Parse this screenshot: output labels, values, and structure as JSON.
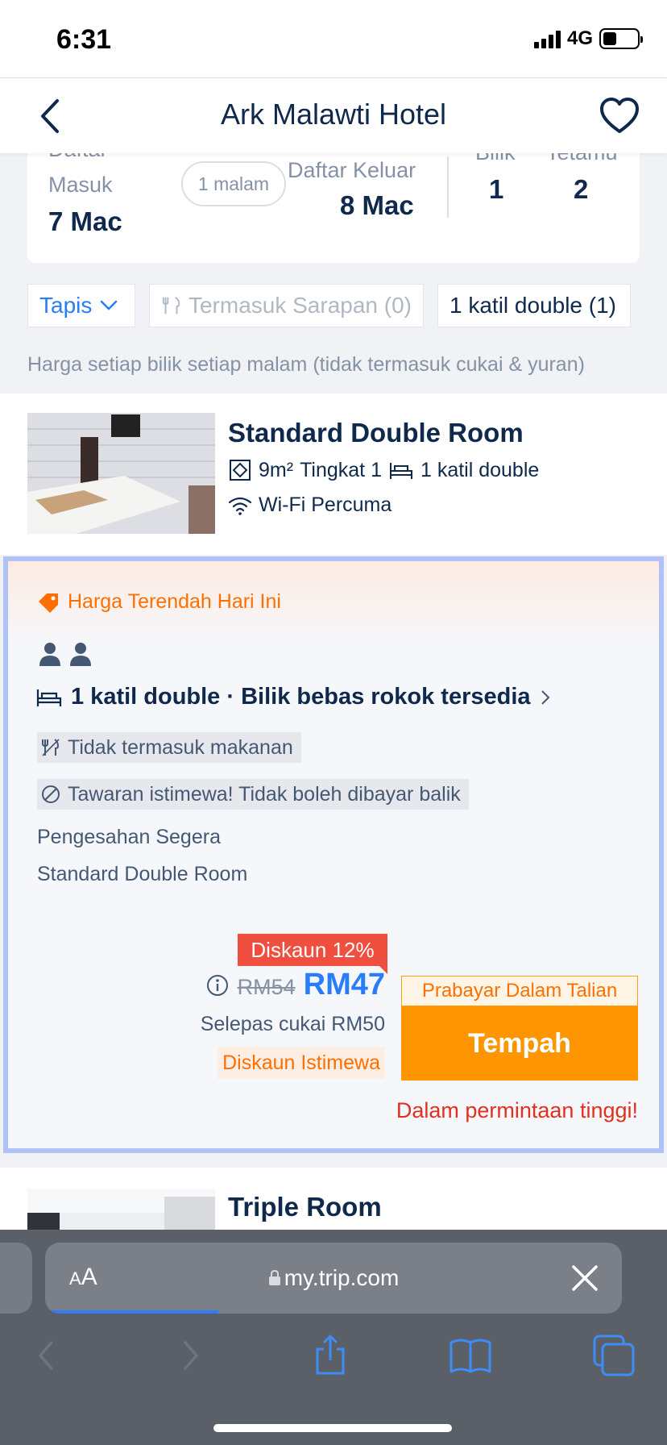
{
  "status_bar": {
    "time": "6:31",
    "network": "4G"
  },
  "header": {
    "title": "Ark Malawti Hotel"
  },
  "search_summary": {
    "checkin_label_line1": "Daftar",
    "checkin_label_line2": "Masuk",
    "checkin_date": "7 Mac",
    "nights": "1 malam",
    "checkout_label": "Daftar Keluar",
    "checkout_date": "8 Mac",
    "rooms_label": "Bilik",
    "rooms": "1",
    "guests_label": "Tetamu",
    "guests": "2"
  },
  "filters": {
    "filter_label": "Tapis",
    "breakfast_chip": "Termasuk Sarapan (0)",
    "bed_chip": "1 katil double (1)"
  },
  "price_note": "Harga setiap bilik setiap malam (tidak termasuk cukai & yuran)",
  "rooms": [
    {
      "name": "Standard Double Room",
      "size": "9m²",
      "floor": "Tingkat 1",
      "bed": "1 katil double",
      "wifi": "Wi-Fi Percuma"
    },
    {
      "name": "Triple Room"
    }
  ],
  "offer": {
    "banner": "Harga Terendah Hari Ini",
    "bed_policy": "1 katil double · Bilik bebas rokok tersedia",
    "meal": "Tidak termasuk makanan",
    "refund": "Tawaran istimewa! Tidak boleh dibayar balik",
    "confirmation": "Pengesahan Segera",
    "room_name": "Standard Double Room",
    "discount_badge": "Diskaun 12%",
    "old_price": "RM54",
    "new_price": "RM47",
    "after_tax": "Selepas cukai RM50",
    "special": "Diskaun Istimewa",
    "prepay": "Prabayar Dalam Talian",
    "book_button": "Tempah",
    "demand": "Dalam permintaan tinggi!"
  },
  "browser": {
    "aa_small": "A",
    "aa_large": "A",
    "url": "my.trip.com",
    "load_progress": 0.3
  },
  "colors": {
    "brand_blue": "#287dfa",
    "navy": "#0f294d",
    "orange": "#ff9500",
    "red": "#f04e3e",
    "offer_border": "#b0c1f5"
  }
}
